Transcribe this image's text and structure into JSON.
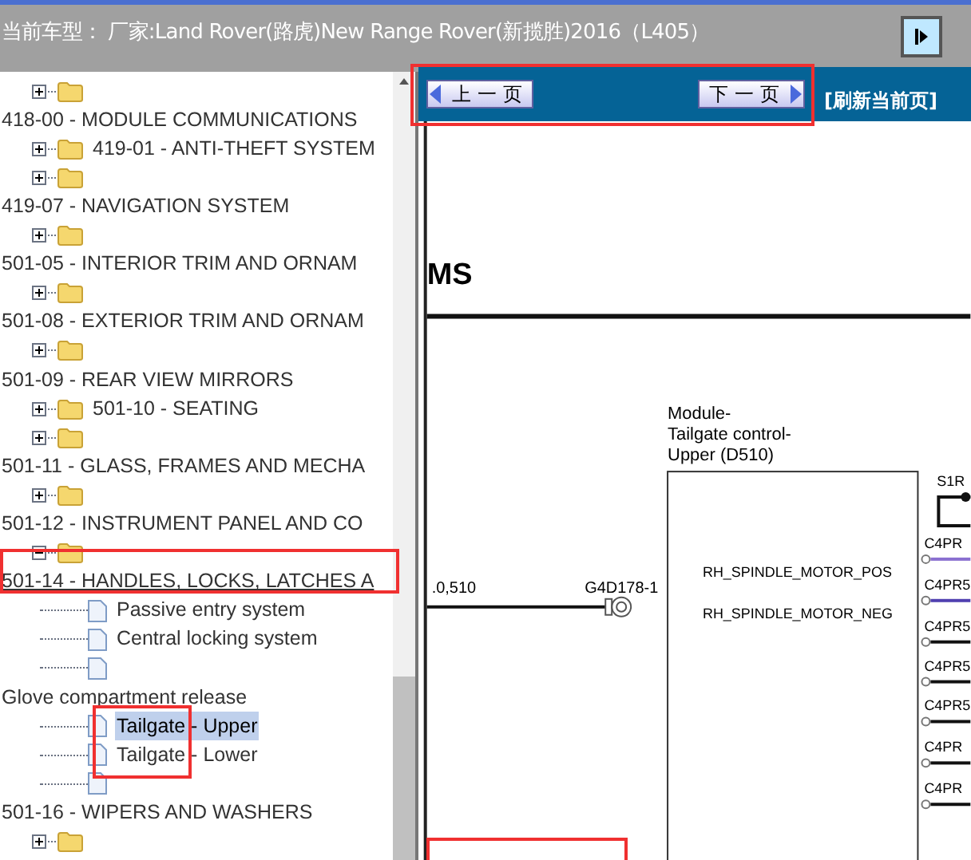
{
  "header": {
    "title": "当前车型： 厂家:Land Rover(路虎)New Range Rover(新揽胜)2016（L405）"
  },
  "toolbar": {
    "prev": "上 一 页",
    "next": "下 一 页",
    "refresh": "[刷新当前页]"
  },
  "tree": [
    {
      "kind": "folder",
      "expanded": false
    },
    {
      "kind": "heading",
      "label": "418-00 - MODULE COMMUNICATIONS",
      "focused": false
    },
    {
      "kind": "folder",
      "expanded": false,
      "label": "419-01 - ANTI-THEFT SYSTEM"
    },
    {
      "kind": "folder",
      "expanded": false
    },
    {
      "kind": "heading",
      "label": "419-07 - NAVIGATION SYSTEM",
      "focused": false
    },
    {
      "kind": "folder",
      "expanded": false
    },
    {
      "kind": "heading",
      "label": "501-05 - INTERIOR TRIM AND ORNAM",
      "focused": false
    },
    {
      "kind": "folder",
      "expanded": false
    },
    {
      "kind": "heading",
      "label": "501-08 - EXTERIOR TRIM AND ORNAM",
      "focused": false
    },
    {
      "kind": "folder",
      "expanded": false
    },
    {
      "kind": "heading",
      "label": "501-09 - REAR VIEW MIRRORS",
      "focused": false
    },
    {
      "kind": "folder",
      "expanded": false,
      "label": "501-10 - SEATING"
    },
    {
      "kind": "folder",
      "expanded": false
    },
    {
      "kind": "heading",
      "label": "501-11 - GLASS, FRAMES AND MECHA",
      "focused": false
    },
    {
      "kind": "folder",
      "expanded": false
    },
    {
      "kind": "heading",
      "label": "501-12 - INSTRUMENT PANEL AND CO",
      "focused": false
    },
    {
      "kind": "folder",
      "expanded": true
    },
    {
      "kind": "heading",
      "label": "501-14 - HANDLES, LOCKS, LATCHES A",
      "focused": true
    },
    {
      "kind": "doc",
      "label": "Passive entry system",
      "selected": false
    },
    {
      "kind": "doc",
      "label": "Central locking system",
      "selected": false
    },
    {
      "kind": "doc"
    },
    {
      "kind": "heading",
      "label": "Glove compartment release",
      "focused": false
    },
    {
      "kind": "doc",
      "label": "Tailgate - Upper",
      "selected": true
    },
    {
      "kind": "doc",
      "label": "Tailgate - Lower",
      "selected": false
    },
    {
      "kind": "doc"
    },
    {
      "kind": "heading",
      "label": "501-16 - WIPERS AND WASHERS",
      "focused": false
    },
    {
      "kind": "folder",
      "expanded": false
    }
  ],
  "diagram": {
    "title": "MS",
    "module": [
      "Module-",
      "Tailgate control-",
      "Upper (D510)"
    ],
    "switch_label": "S1R",
    "left_wire": ".0,510",
    "connector": "G4D178-1",
    "signals": [
      "RH_SPINDLE_MOTOR_POS",
      "RH_SPINDLE_MOTOR_NEG"
    ],
    "pins": [
      {
        "label": "C4PR",
        "color": "#8a6fd0"
      },
      {
        "label": "C4PR5",
        "color": "#5040b0"
      },
      {
        "label": "C4PR5",
        "color": "#111111"
      },
      {
        "label": "C4PR5",
        "color": "#111111"
      },
      {
        "label": "C4PR5",
        "color": "#111111"
      },
      {
        "label": "C4PR",
        "color": "#111111"
      },
      {
        "label": "C4PR",
        "color": "#111111"
      }
    ]
  }
}
